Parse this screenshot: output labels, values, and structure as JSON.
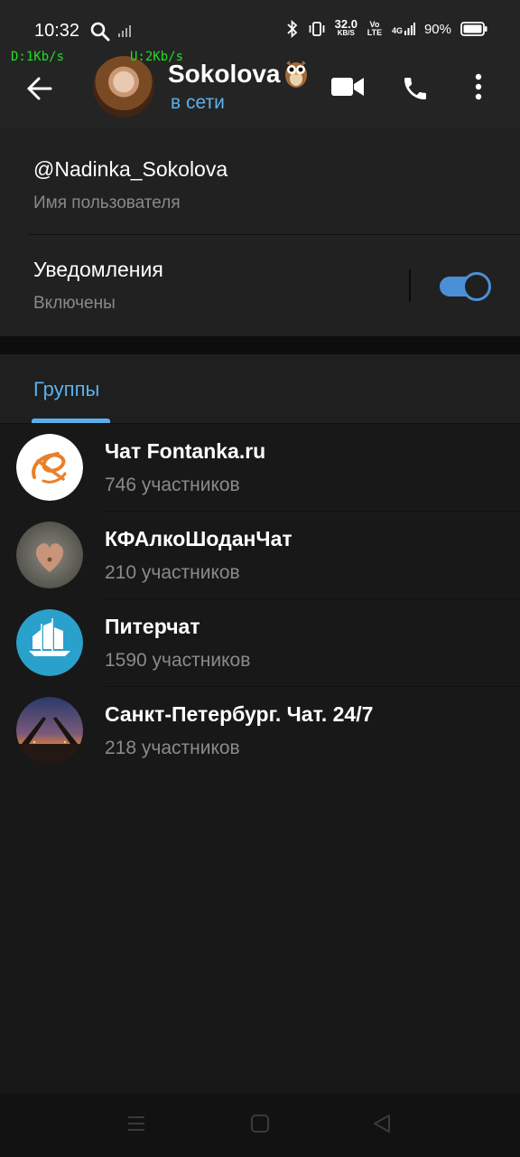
{
  "status_bar": {
    "time": "10:32",
    "net_down": "D:1Kb/s",
    "net_up": "U:2Kb/s",
    "speed_value": "32.0",
    "speed_unit": "KB/S",
    "volte": "Vo LTE",
    "network": "4G",
    "battery": "90%"
  },
  "header": {
    "name": "Sokolova",
    "status": "в сети"
  },
  "profile": {
    "username": "@Nadinka_Sokolova",
    "username_label": "Имя пользователя",
    "notifications_title": "Уведомления",
    "notifications_status": "Включены",
    "notifications_on": true
  },
  "tabs": {
    "groups": "Группы"
  },
  "groups": [
    {
      "name": "Чат Fontanka.ru",
      "members": "746 участников"
    },
    {
      "name": "КФАлкоШоданЧат",
      "members": "210 участников"
    },
    {
      "name": "Питерчат",
      "members": "1590 участников"
    },
    {
      "name": "Санкт-Петербург. Чат. 24/7",
      "members": "218 участников"
    }
  ],
  "colors": {
    "accent": "#5ab0ee",
    "toggle": "#4a90d6",
    "background": "#181818",
    "card": "#212121"
  }
}
